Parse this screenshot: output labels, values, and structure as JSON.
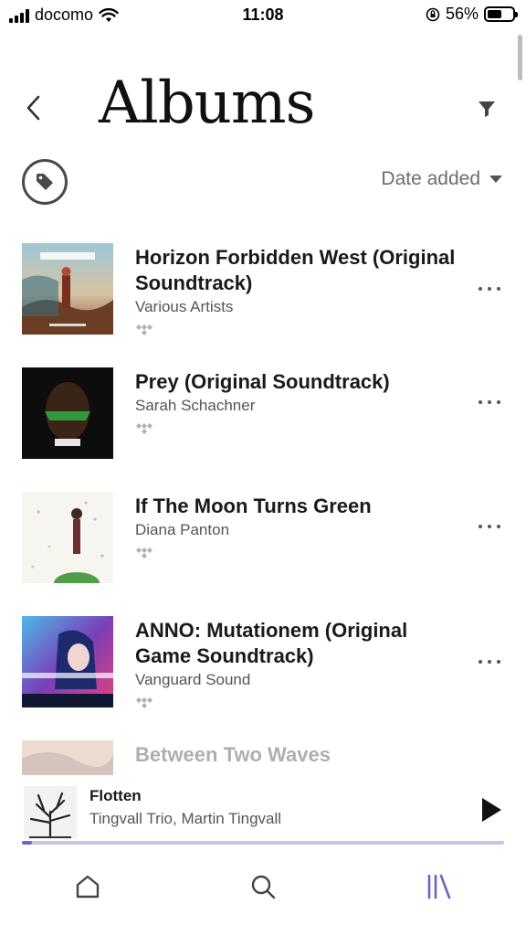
{
  "status_bar": {
    "carrier": "docomo",
    "time": "11:08",
    "battery": "56%",
    "battery_level": 0.56
  },
  "header": {
    "title": "Albums",
    "back_icon": "chevron-left-icon",
    "filter_icon": "filter-icon"
  },
  "toolbar": {
    "tag_icon": "tag-icon",
    "sort_label": "Date added",
    "sort_icon": "caret-down-icon"
  },
  "albums": [
    {
      "title": "Horizon Forbidden West (Original Soundtrack)",
      "artist": "Various Artists"
    },
    {
      "title": "Prey (Original Soundtrack)",
      "artist": "Sarah Schachner"
    },
    {
      "title": "If The Moon Turns Green",
      "artist": "Diana Panton"
    },
    {
      "title": "ANNO: Mutationem (Original Game Soundtrack)",
      "artist": "Vanguard Sound"
    },
    {
      "title": "Between Two Waves",
      "artist": ""
    }
  ],
  "mini_player": {
    "title": "Flotten",
    "artist": "Tingvall Trio, Martin Tingvall",
    "progress": 0.02,
    "play_icon": "play-icon"
  },
  "tab_bar": {
    "items": [
      {
        "icon": "home-icon",
        "active": false
      },
      {
        "icon": "search-icon",
        "active": false
      },
      {
        "icon": "library-icon",
        "active": true
      }
    ]
  },
  "colors": {
    "accent": "#6e63c8",
    "text_primary": "#1a1a1a",
    "text_secondary": "#555555"
  }
}
